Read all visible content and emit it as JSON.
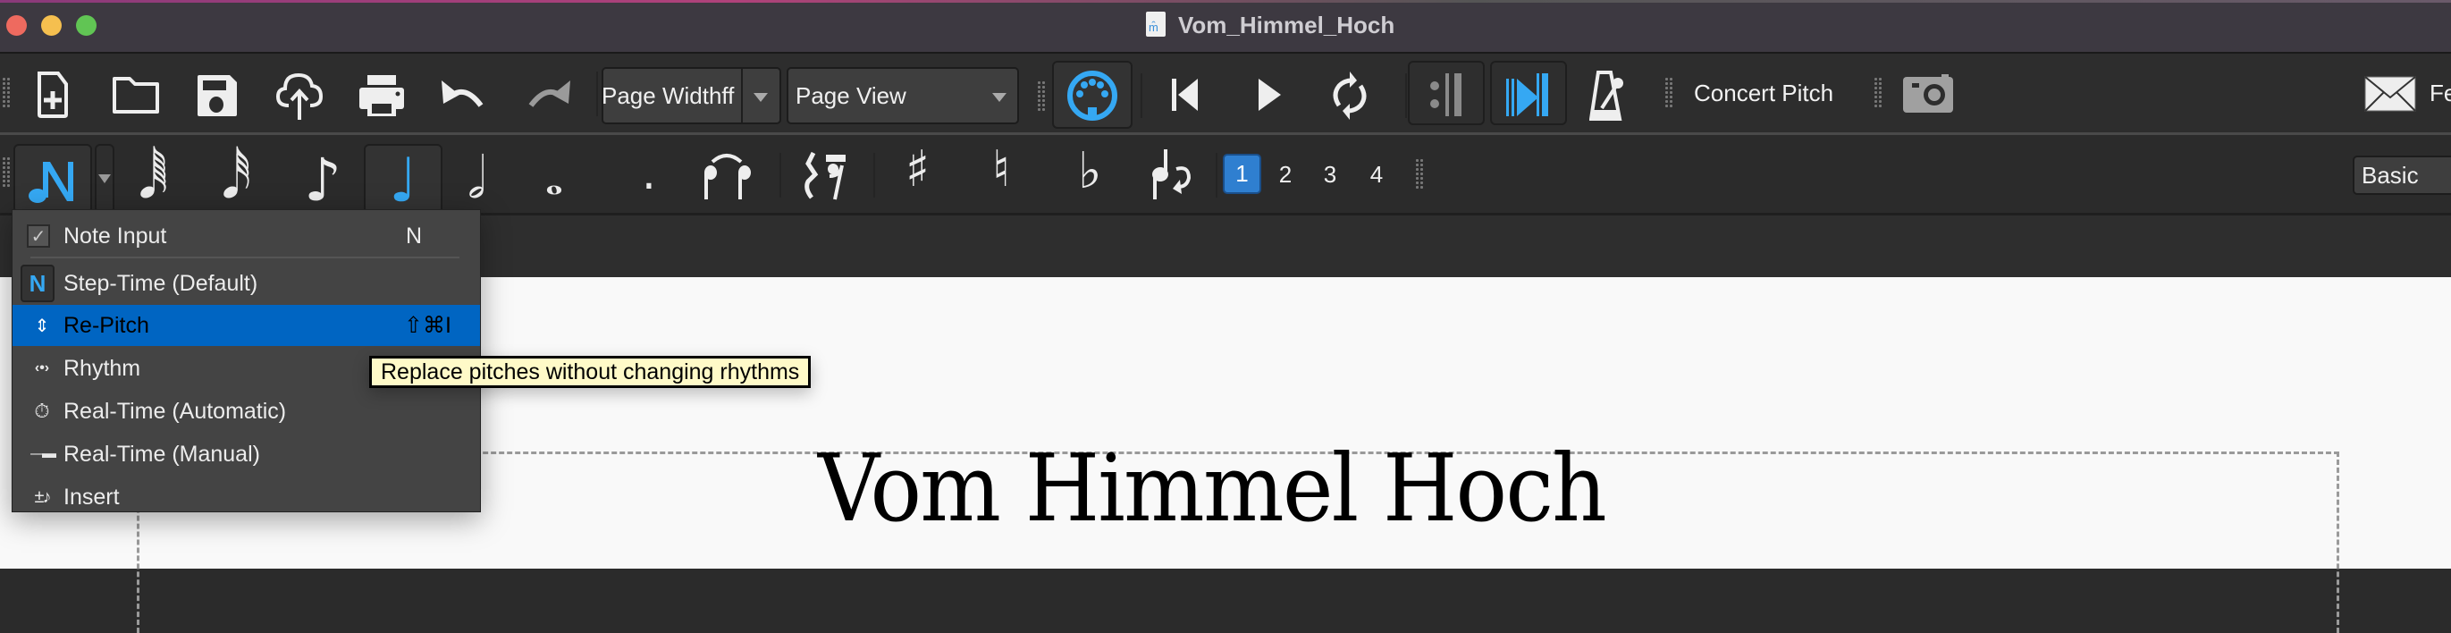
{
  "window": {
    "title": "Vom_Himmel_Hoch",
    "doc_icon_glyph": "m̂"
  },
  "toolbar1": {
    "icons": [
      "new-score-icon",
      "open-folder-icon",
      "save-icon",
      "upload-cloud-icon",
      "print-icon",
      "undo-icon",
      "redo-icon"
    ],
    "zoom_combo": {
      "value": "Page Widthff"
    },
    "view_combo": {
      "value": "Page View"
    },
    "playback": [
      "midi-input-icon",
      "rewind-icon",
      "play-icon",
      "loop-icon",
      "repeat-playback-icon",
      "pan-score-icon",
      "metronome-icon"
    ],
    "concert_pitch_label": "Concert Pitch",
    "image_capture_icon": "camera-icon",
    "feedback_icon": "envelope-icon",
    "feedback_label_partial": "Fe"
  },
  "toolbar2": {
    "note_input_glyph": "N",
    "durations": [
      {
        "name": "64th-note",
        "glyph": "𝅘𝅥𝅱"
      },
      {
        "name": "32nd-note",
        "glyph": "𝅘𝅥𝅰"
      },
      {
        "name": "eighth-note",
        "glyph": "♪"
      },
      {
        "name": "quarter-note",
        "glyph": "♩",
        "active": true
      },
      {
        "name": "half-note",
        "glyph": "𝅗𝅥"
      },
      {
        "name": "whole-note",
        "glyph": "𝅝"
      },
      {
        "name": "augmentation-dot",
        "glyph": "."
      }
    ],
    "modifiers": [
      {
        "name": "tie",
        "glyph": "⁀"
      },
      {
        "name": "rest",
        "glyph": "𝄽"
      },
      {
        "name": "sharp",
        "glyph": "♯"
      },
      {
        "name": "natural",
        "glyph": "♮"
      },
      {
        "name": "flat",
        "glyph": "♭"
      },
      {
        "name": "flip-direction",
        "glyph": "↻"
      }
    ],
    "voices": [
      "1",
      "2",
      "3",
      "4"
    ],
    "active_voice": "1",
    "workspace_combo": {
      "value": "Basic"
    }
  },
  "menu": {
    "items": [
      {
        "label": "Note Input",
        "shortcut": "N",
        "icon": "checkbox-checked",
        "glyph": "✓"
      },
      {
        "label": "Step-Time (Default)",
        "shortcut": "",
        "icon": "step-time",
        "glyph": "N"
      },
      {
        "label": "Re-Pitch",
        "shortcut": "⇧⌘I",
        "icon": "re-pitch",
        "glyph": "⇕",
        "selected": true
      },
      {
        "label": "Rhythm",
        "shortcut": "",
        "icon": "rhythm",
        "glyph": "‹•›"
      },
      {
        "label": "Real-Time (Automatic)",
        "shortcut": "",
        "icon": "stopwatch",
        "glyph": "⏱"
      },
      {
        "label": "Real-Time (Manual)",
        "shortcut": "",
        "icon": "pedal",
        "glyph": "—▬"
      },
      {
        "label": "Insert",
        "shortcut": "",
        "icon": "insert-note",
        "glyph": "±♪"
      }
    ]
  },
  "tooltip": {
    "text": "Replace pitches without changing rhythms"
  },
  "score": {
    "title": "Vom Himmel Hoch"
  },
  "colors": {
    "accent_blue": "#35a8f3",
    "menu_selected": "#0065c2",
    "voice1": "#2f7fd0",
    "tooltip_bg": "#fffac8"
  }
}
